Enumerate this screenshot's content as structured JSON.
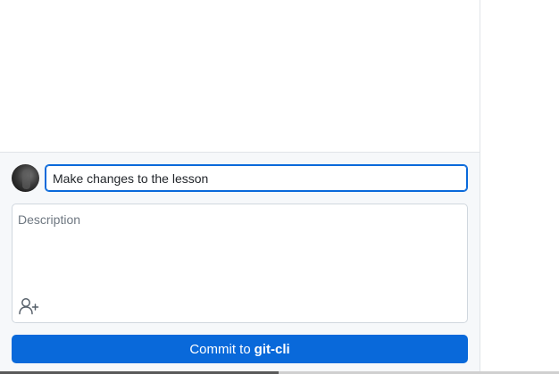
{
  "commit": {
    "summary_value": "Make changes to the lesson",
    "description_placeholder": "Description",
    "button_prefix": "Commit to",
    "branch_name": "git-cli"
  },
  "icons": {
    "avatar": "user-avatar",
    "coauthor": "person-add-icon"
  },
  "colors": {
    "accent": "#0969da",
    "panel_bg": "#f6f8fa",
    "border": "#d0d7de"
  }
}
